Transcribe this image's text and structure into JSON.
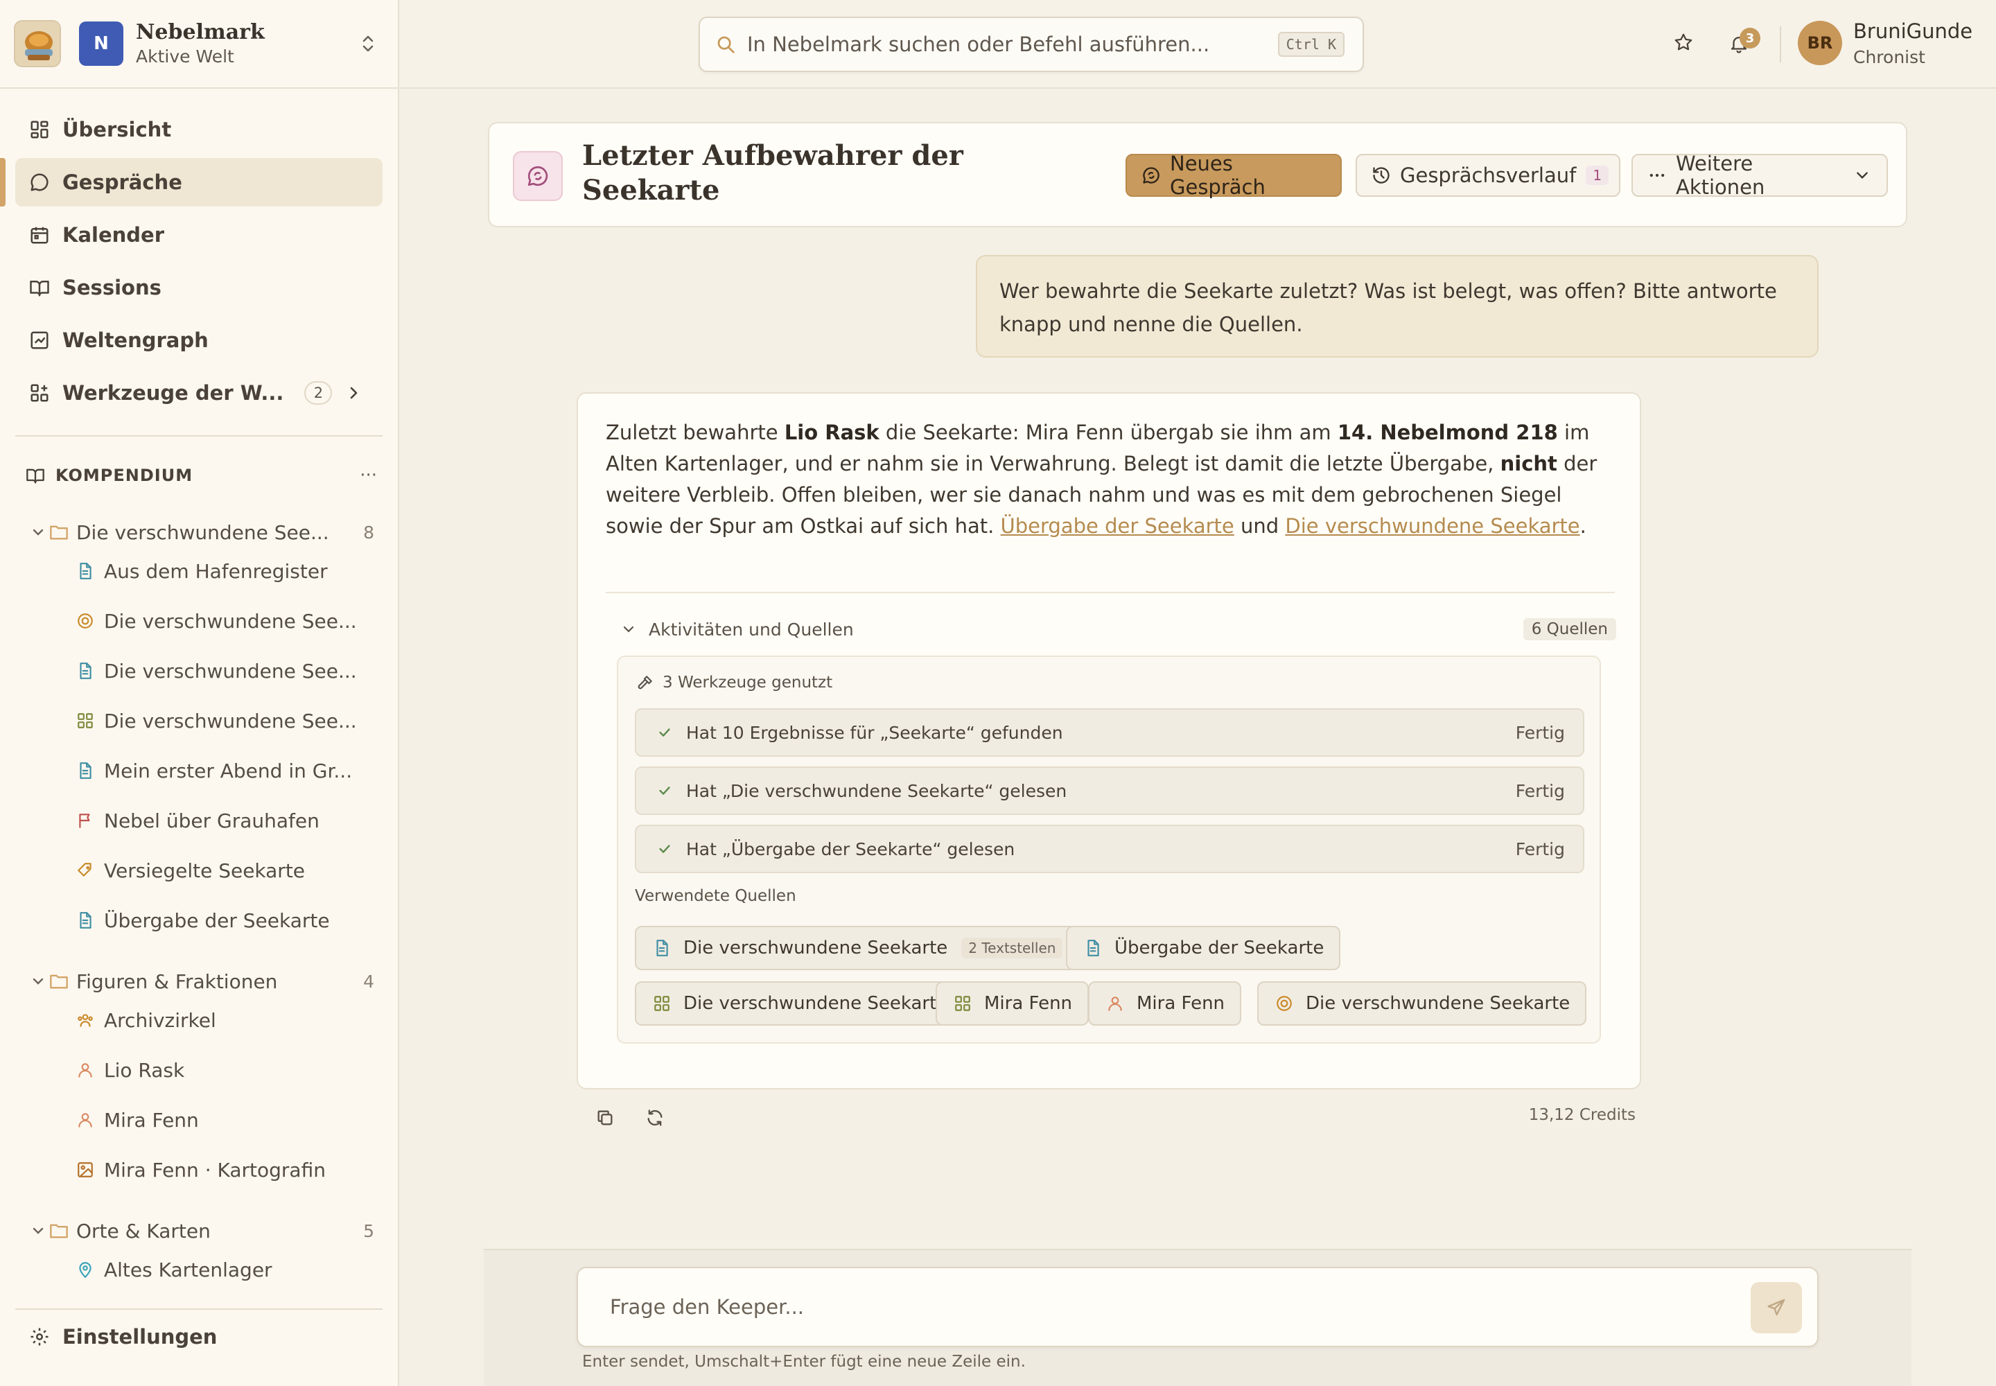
{
  "workspace": {
    "name": "Nebelmark",
    "status": "Aktive Welt",
    "badge": "N"
  },
  "nav": {
    "items": [
      {
        "label": "Übersicht",
        "icon": "grid-icon"
      },
      {
        "label": "Gespräche",
        "icon": "chat-bubble-icon",
        "active": true
      },
      {
        "label": "Kalender",
        "icon": "calendar-icon"
      },
      {
        "label": "Sessions",
        "icon": "book-icon"
      },
      {
        "label": "Weltengraph",
        "icon": "chart-icon"
      },
      {
        "label": "Werkzeuge der W...",
        "icon": "apps-plus-icon",
        "count": "2"
      }
    ],
    "settings": "Einstellungen"
  },
  "compendium": {
    "title": "KOMPENDIUM",
    "more": "···",
    "folders": [
      {
        "label": "Die verschwundene See...",
        "count": "8",
        "items": [
          {
            "label": "Aus dem Hafenregister",
            "icon": "document-icon",
            "color": "#3f8ea3"
          },
          {
            "label": "Die verschwundene See...",
            "icon": "target-icon",
            "color": "#c98a2b"
          },
          {
            "label": "Die verschwundene See...",
            "icon": "document-icon",
            "color": "#3f8ea3"
          },
          {
            "label": "Die verschwundene See...",
            "icon": "grid-icon",
            "color": "#7d8a3b"
          },
          {
            "label": "Mein erster Abend in Gr...",
            "icon": "document-icon",
            "color": "#3f8ea3"
          },
          {
            "label": "Nebel über Grauhafen",
            "icon": "flag-icon",
            "color": "#c0504d"
          },
          {
            "label": "Versiegelte Seekarte",
            "icon": "tag-icon",
            "color": "#c98a2b"
          },
          {
            "label": "Übergabe der Seekarte",
            "icon": "document-icon",
            "color": "#3f8ea3"
          }
        ]
      },
      {
        "label": "Figuren & Fraktionen",
        "count": "4",
        "items": [
          {
            "label": "Archivzirkel",
            "icon": "group-icon",
            "color": "#c98a2b"
          },
          {
            "label": "Lio Rask",
            "icon": "person-icon",
            "color": "#d98a62"
          },
          {
            "label": "Mira Fenn",
            "icon": "person-icon",
            "color": "#d98a62"
          },
          {
            "label": "Mira Fenn · Kartografin",
            "icon": "image-icon",
            "color": "#b5702a"
          }
        ]
      },
      {
        "label": "Orte & Karten",
        "count": "5",
        "items": [
          {
            "label": "Altes Kartenlager",
            "icon": "location-pin-icon",
            "color": "#3aa3b8"
          }
        ]
      }
    ]
  },
  "topbar": {
    "search_placeholder": "In Nebelmark suchen oder Befehl ausführen...",
    "shortcut": "Ctrl K",
    "notifications": "3",
    "user": {
      "initials": "BR",
      "name": "BruniGunde",
      "role": "Chronist"
    }
  },
  "conversation": {
    "title": "Letzter Aufbewahrer der Seekarte",
    "new_button": "Neues Gespräch",
    "history_button": "Gesprächsverlauf",
    "history_count": "1",
    "more_button": "Weitere Aktionen"
  },
  "messages": {
    "user": "Wer bewahrte die Seekarte zuletzt? Was ist belegt, was offen? Bitte antworte knapp und nenne die Quellen.",
    "answer": {
      "p1": "Zuletzt bewahrte ",
      "b1": "Lio Rask",
      "p2": " die Seekarte: Mira Fenn übergab sie ihm am ",
      "b2": "14. Nebelmond 218",
      "p3": " im Alten Kartenlager, und er nahm sie in Verwahrung. Belegt ist damit die letzte Übergabe, ",
      "b3": "nicht",
      "p4": " der weitere Verbleib. Offen bleiben, wer sie danach nahm und was es mit dem gebrochenen Siegel sowie der Spur am Ostkai auf sich hat. ",
      "link1": "Übergabe der Seekarte",
      "p5": " und ",
      "link2": "Die verschwundene Seekarte",
      "p6": "."
    },
    "activity": {
      "title": "Aktivitäten und Quellen",
      "sources_count": "6 Quellen",
      "tools_title": "3 Werkzeuge genutzt",
      "tools": [
        {
          "label": "Hat 10 Ergebnisse für „Seekarte“ gefunden",
          "status": "Fertig"
        },
        {
          "label": "Hat „Die verschwundene Seekarte“ gelesen",
          "status": "Fertig"
        },
        {
          "label": "Hat „Übergabe der Seekarte“ gelesen",
          "status": "Fertig"
        }
      ],
      "sources_title": "Verwendete Quellen",
      "sources": [
        {
          "label": "Die verschwundene Seekarte",
          "sub": "2 Textstellen",
          "icon": "document-icon",
          "color": "#3f8ea3"
        },
        {
          "label": "Übergabe der Seekarte",
          "icon": "document-icon",
          "color": "#3f8ea3"
        },
        {
          "label": "Die verschwundene Seekarte",
          "icon": "grid-icon",
          "color": "#7d8a3b"
        },
        {
          "label": "Mira Fenn",
          "icon": "grid-icon",
          "color": "#7d8a3b"
        },
        {
          "label": "Mira Fenn",
          "icon": "person-icon",
          "color": "#d98a62"
        },
        {
          "label": "Die verschwundene Seekarte",
          "icon": "target-icon",
          "color": "#c98a2b"
        }
      ]
    },
    "credits": "13,12 Credits"
  },
  "composer": {
    "placeholder": "Frage den Keeper...",
    "hint": "Enter sendet, Umschalt+Enter fügt eine neue Zeile ein."
  }
}
